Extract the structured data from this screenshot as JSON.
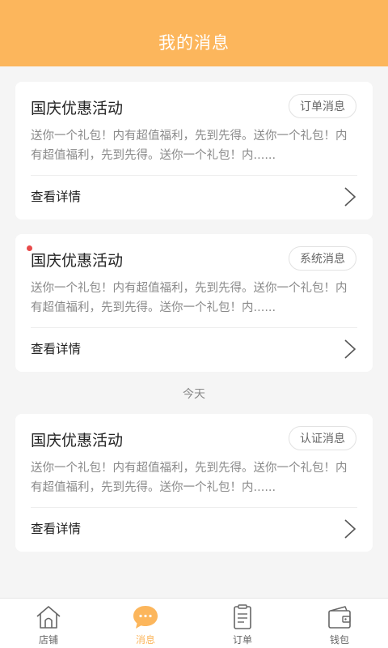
{
  "header": {
    "title": "我的消息"
  },
  "messages": [
    {
      "title": "国庆优惠活动",
      "tag": "订单消息",
      "body": "送你一个礼包！内有超值福利，先到先得。送你一个礼包！内有超值福利，先到先得。送你一个礼包！内......",
      "detail": "查看详情",
      "unread": false
    },
    {
      "title": "国庆优惠活动",
      "tag": "系统消息",
      "body": "送你一个礼包！内有超值福利，先到先得。送你一个礼包！内有超值福利，先到先得。送你一个礼包！内......",
      "detail": "查看详情",
      "unread": true
    },
    {
      "title": "国庆优惠活动",
      "tag": "认证消息",
      "body": "送你一个礼包！内有超值福利，先到先得。送你一个礼包！内有超值福利，先到先得。送你一个礼包！内......",
      "detail": "查看详情",
      "unread": false
    }
  ],
  "date_separator": "今天",
  "tabbar": {
    "active_color": "#fcb65c",
    "items": [
      {
        "label": "店铺",
        "icon": "store-icon"
      },
      {
        "label": "消息",
        "icon": "message-icon",
        "active": true
      },
      {
        "label": "订单",
        "icon": "order-icon"
      },
      {
        "label": "钱包",
        "icon": "wallet-icon"
      }
    ]
  }
}
